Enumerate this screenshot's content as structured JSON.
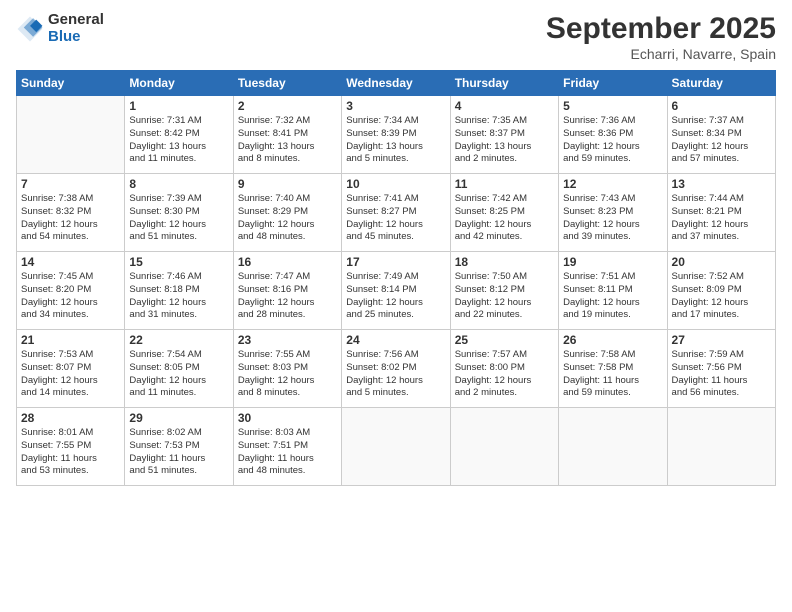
{
  "logo": {
    "general": "General",
    "blue": "Blue"
  },
  "title": "September 2025",
  "subtitle": "Echarri, Navarre, Spain",
  "days_of_week": [
    "Sunday",
    "Monday",
    "Tuesday",
    "Wednesday",
    "Thursday",
    "Friday",
    "Saturday"
  ],
  "weeks": [
    [
      {
        "day": "",
        "sunrise": "",
        "sunset": "",
        "daylight": ""
      },
      {
        "day": "1",
        "sunrise": "Sunrise: 7:31 AM",
        "sunset": "Sunset: 8:42 PM",
        "daylight": "Daylight: 13 hours and 11 minutes."
      },
      {
        "day": "2",
        "sunrise": "Sunrise: 7:32 AM",
        "sunset": "Sunset: 8:41 PM",
        "daylight": "Daylight: 13 hours and 8 minutes."
      },
      {
        "day": "3",
        "sunrise": "Sunrise: 7:34 AM",
        "sunset": "Sunset: 8:39 PM",
        "daylight": "Daylight: 13 hours and 5 minutes."
      },
      {
        "day": "4",
        "sunrise": "Sunrise: 7:35 AM",
        "sunset": "Sunset: 8:37 PM",
        "daylight": "Daylight: 13 hours and 2 minutes."
      },
      {
        "day": "5",
        "sunrise": "Sunrise: 7:36 AM",
        "sunset": "Sunset: 8:36 PM",
        "daylight": "Daylight: 12 hours and 59 minutes."
      },
      {
        "day": "6",
        "sunrise": "Sunrise: 7:37 AM",
        "sunset": "Sunset: 8:34 PM",
        "daylight": "Daylight: 12 hours and 57 minutes."
      }
    ],
    [
      {
        "day": "7",
        "sunrise": "Sunrise: 7:38 AM",
        "sunset": "Sunset: 8:32 PM",
        "daylight": "Daylight: 12 hours and 54 minutes."
      },
      {
        "day": "8",
        "sunrise": "Sunrise: 7:39 AM",
        "sunset": "Sunset: 8:30 PM",
        "daylight": "Daylight: 12 hours and 51 minutes."
      },
      {
        "day": "9",
        "sunrise": "Sunrise: 7:40 AM",
        "sunset": "Sunset: 8:29 PM",
        "daylight": "Daylight: 12 hours and 48 minutes."
      },
      {
        "day": "10",
        "sunrise": "Sunrise: 7:41 AM",
        "sunset": "Sunset: 8:27 PM",
        "daylight": "Daylight: 12 hours and 45 minutes."
      },
      {
        "day": "11",
        "sunrise": "Sunrise: 7:42 AM",
        "sunset": "Sunset: 8:25 PM",
        "daylight": "Daylight: 12 hours and 42 minutes."
      },
      {
        "day": "12",
        "sunrise": "Sunrise: 7:43 AM",
        "sunset": "Sunset: 8:23 PM",
        "daylight": "Daylight: 12 hours and 39 minutes."
      },
      {
        "day": "13",
        "sunrise": "Sunrise: 7:44 AM",
        "sunset": "Sunset: 8:21 PM",
        "daylight": "Daylight: 12 hours and 37 minutes."
      }
    ],
    [
      {
        "day": "14",
        "sunrise": "Sunrise: 7:45 AM",
        "sunset": "Sunset: 8:20 PM",
        "daylight": "Daylight: 12 hours and 34 minutes."
      },
      {
        "day": "15",
        "sunrise": "Sunrise: 7:46 AM",
        "sunset": "Sunset: 8:18 PM",
        "daylight": "Daylight: 12 hours and 31 minutes."
      },
      {
        "day": "16",
        "sunrise": "Sunrise: 7:47 AM",
        "sunset": "Sunset: 8:16 PM",
        "daylight": "Daylight: 12 hours and 28 minutes."
      },
      {
        "day": "17",
        "sunrise": "Sunrise: 7:49 AM",
        "sunset": "Sunset: 8:14 PM",
        "daylight": "Daylight: 12 hours and 25 minutes."
      },
      {
        "day": "18",
        "sunrise": "Sunrise: 7:50 AM",
        "sunset": "Sunset: 8:12 PM",
        "daylight": "Daylight: 12 hours and 22 minutes."
      },
      {
        "day": "19",
        "sunrise": "Sunrise: 7:51 AM",
        "sunset": "Sunset: 8:11 PM",
        "daylight": "Daylight: 12 hours and 19 minutes."
      },
      {
        "day": "20",
        "sunrise": "Sunrise: 7:52 AM",
        "sunset": "Sunset: 8:09 PM",
        "daylight": "Daylight: 12 hours and 17 minutes."
      }
    ],
    [
      {
        "day": "21",
        "sunrise": "Sunrise: 7:53 AM",
        "sunset": "Sunset: 8:07 PM",
        "daylight": "Daylight: 12 hours and 14 minutes."
      },
      {
        "day": "22",
        "sunrise": "Sunrise: 7:54 AM",
        "sunset": "Sunset: 8:05 PM",
        "daylight": "Daylight: 12 hours and 11 minutes."
      },
      {
        "day": "23",
        "sunrise": "Sunrise: 7:55 AM",
        "sunset": "Sunset: 8:03 PM",
        "daylight": "Daylight: 12 hours and 8 minutes."
      },
      {
        "day": "24",
        "sunrise": "Sunrise: 7:56 AM",
        "sunset": "Sunset: 8:02 PM",
        "daylight": "Daylight: 12 hours and 5 minutes."
      },
      {
        "day": "25",
        "sunrise": "Sunrise: 7:57 AM",
        "sunset": "Sunset: 8:00 PM",
        "daylight": "Daylight: 12 hours and 2 minutes."
      },
      {
        "day": "26",
        "sunrise": "Sunrise: 7:58 AM",
        "sunset": "Sunset: 7:58 PM",
        "daylight": "Daylight: 11 hours and 59 minutes."
      },
      {
        "day": "27",
        "sunrise": "Sunrise: 7:59 AM",
        "sunset": "Sunset: 7:56 PM",
        "daylight": "Daylight: 11 hours and 56 minutes."
      }
    ],
    [
      {
        "day": "28",
        "sunrise": "Sunrise: 8:01 AM",
        "sunset": "Sunset: 7:55 PM",
        "daylight": "Daylight: 11 hours and 53 minutes."
      },
      {
        "day": "29",
        "sunrise": "Sunrise: 8:02 AM",
        "sunset": "Sunset: 7:53 PM",
        "daylight": "Daylight: 11 hours and 51 minutes."
      },
      {
        "day": "30",
        "sunrise": "Sunrise: 8:03 AM",
        "sunset": "Sunset: 7:51 PM",
        "daylight": "Daylight: 11 hours and 48 minutes."
      },
      {
        "day": "",
        "sunrise": "",
        "sunset": "",
        "daylight": ""
      },
      {
        "day": "",
        "sunrise": "",
        "sunset": "",
        "daylight": ""
      },
      {
        "day": "",
        "sunrise": "",
        "sunset": "",
        "daylight": ""
      },
      {
        "day": "",
        "sunrise": "",
        "sunset": "",
        "daylight": ""
      }
    ]
  ]
}
